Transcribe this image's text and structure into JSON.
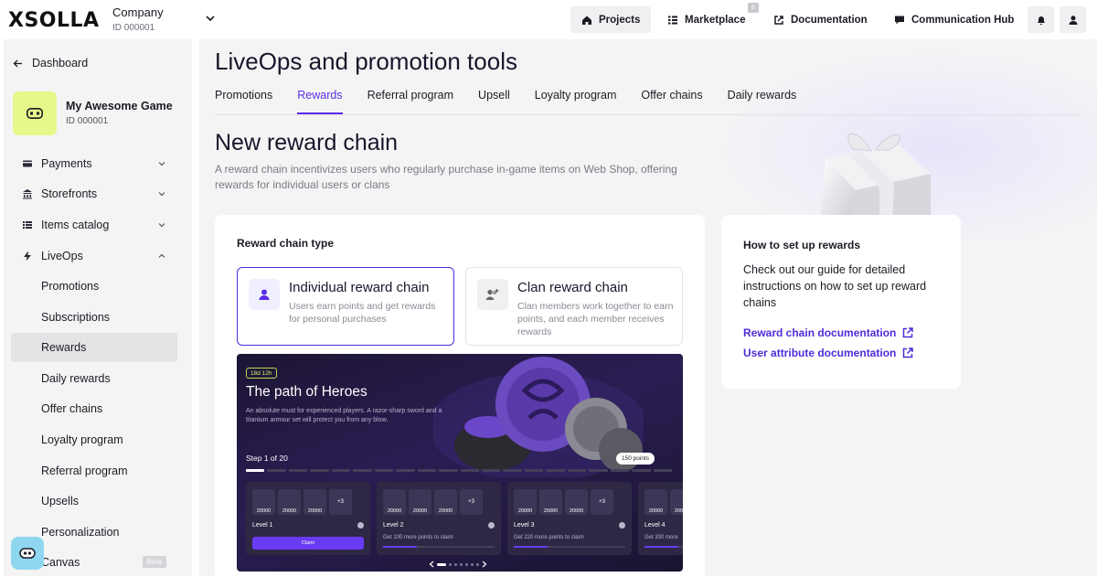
{
  "topbar": {
    "logo": "XSOLLA",
    "company_name": "Company",
    "company_id": "ID 000001",
    "nav": [
      {
        "label": "Projects",
        "icon": "home-icon"
      },
      {
        "label": "Marketplace",
        "icon": "grid-icon",
        "badge": "8"
      },
      {
        "label": "Documentation",
        "icon": "external-link-icon"
      },
      {
        "label": "Communication Hub",
        "icon": "chat-icon"
      }
    ]
  },
  "sidebar": {
    "back_label": "Dashboard",
    "game": {
      "name": "My Awesome Game",
      "id": "ID 000001"
    },
    "items": [
      {
        "label": "Payments",
        "icon": "card-icon"
      },
      {
        "label": "Storefronts",
        "icon": "store-icon"
      },
      {
        "label": "Items catalog",
        "icon": "list-icon"
      },
      {
        "label": "LiveOps",
        "icon": "bolt-icon"
      }
    ],
    "subitems": [
      {
        "label": "Promotions"
      },
      {
        "label": "Subscriptions"
      },
      {
        "label": "Rewards"
      },
      {
        "label": "Daily rewards"
      },
      {
        "label": "Offer chains"
      },
      {
        "label": "Loyalty program"
      },
      {
        "label": "Referral program"
      },
      {
        "label": "Upsells"
      },
      {
        "label": "Personalization"
      },
      {
        "label": "Canvas",
        "badge": "Beta"
      }
    ]
  },
  "main": {
    "page_title": "LiveOps and promotion tools",
    "tabs": [
      "Promotions",
      "Rewards",
      "Referral program",
      "Upsell",
      "Loyalty program",
      "Offer chains",
      "Daily rewards"
    ],
    "active_tab": "Rewards",
    "section_title": "New reward chain",
    "section_desc": "A reward chain incentivizes users who regularly purchase in-game items on Web Shop, offering rewards for individual users or clans",
    "chain_type": {
      "label": "Reward chain type",
      "options": [
        {
          "title": "Individual reward chain",
          "desc": "Users earn points and get rewards for personal purchases",
          "selected": true
        },
        {
          "title": "Clan reward chain",
          "desc": "Clan members work together to earn points, and each member receives rewards",
          "selected": false
        }
      ]
    },
    "preview": {
      "timer": "18d 12h",
      "title": "The path of Heroes",
      "desc": "An absolute must for experienced players. A razor-sharp sword and a titanium armour set will protect you from any blow.",
      "step": "Step 1 of 20",
      "points": "150 points",
      "segments": 20,
      "active_segments": 1,
      "levels": [
        {
          "name": "Level 1",
          "items": [
            "20000",
            "20000",
            "20000"
          ],
          "more": "+3",
          "claim": "Claim"
        },
        {
          "name": "Level 2",
          "items": [
            "20000",
            "20000",
            "20000"
          ],
          "more": "+3",
          "note": "Get 100 more points to claim",
          "progress": 0.3
        },
        {
          "name": "Level 3",
          "items": [
            "20000",
            "20000",
            "20000"
          ],
          "more": "+3",
          "note": "Get 220 more points to claim",
          "progress": 0.3
        },
        {
          "name": "Level 4",
          "items": [
            "20000",
            "20000"
          ],
          "note": "Get 330 more",
          "progress": 0.3
        }
      ]
    },
    "help": {
      "title": "How to set up rewards",
      "text": "Check out our guide for detailed instructions on how to set up reward chains",
      "links": [
        "Reward chain documentation",
        "User attribute documentation"
      ]
    }
  },
  "colors": {
    "accent": "#5a2ee6",
    "lime": "#e7f78a",
    "assistant": "#8fd7f0"
  }
}
